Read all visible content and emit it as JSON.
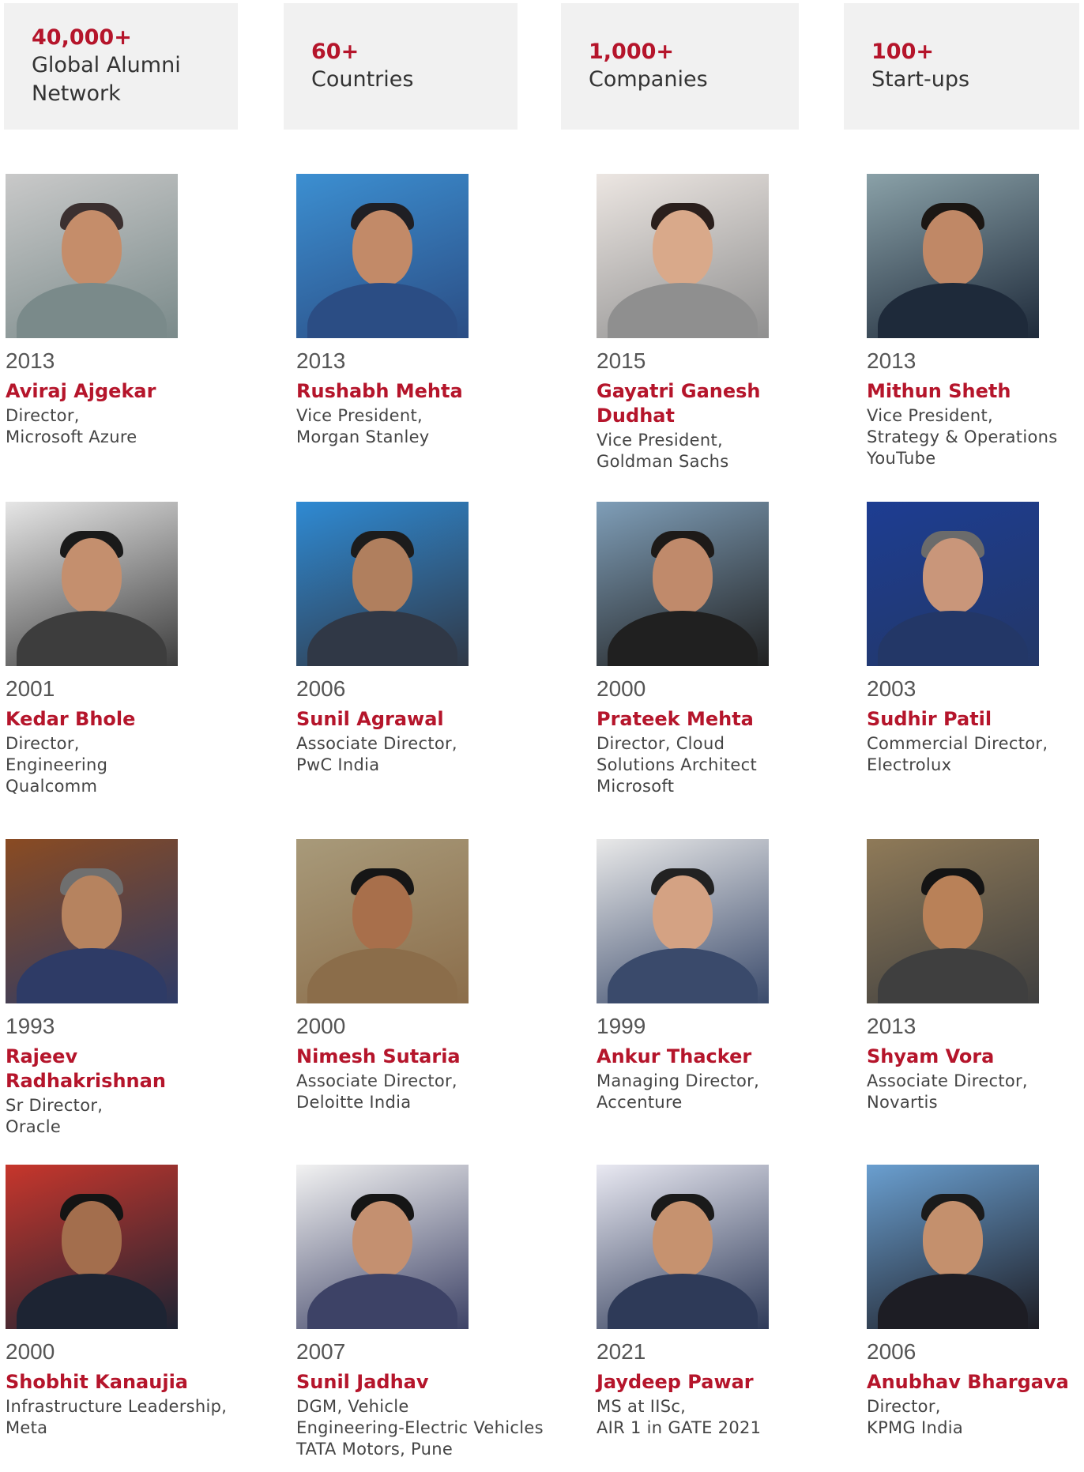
{
  "stats": [
    {
      "value": "40,000+",
      "label": "Global Alumni\nNetwork"
    },
    {
      "value": "60+",
      "label": "Countries"
    },
    {
      "value": "1,000+",
      "label": "Companies"
    },
    {
      "value": "100+",
      "label": "Start-ups"
    }
  ],
  "colors": {
    "accent": "#b5152b",
    "stat_bg": "#f1f1f1",
    "text": "#444444"
  },
  "alumni": [
    {
      "year": "2013",
      "name": "Aviraj Ajgekar",
      "role": [
        "Director,",
        "Microsoft Azure"
      ]
    },
    {
      "year": "2013",
      "name": "Rushabh Mehta",
      "role": [
        "Vice President,",
        "Morgan Stanley"
      ]
    },
    {
      "year": "2015",
      "name": "Gayatri Ganesh Dudhat",
      "role": [
        "Vice President,",
        "Goldman Sachs"
      ]
    },
    {
      "year": "2013",
      "name": "Mithun Sheth",
      "role": [
        "Vice President,",
        "Strategy & Operations",
        "YouTube"
      ]
    },
    {
      "year": "2001",
      "name": "Kedar Bhole",
      "role": [
        "Director,",
        "Engineering",
        "Qualcomm"
      ]
    },
    {
      "year": "2006",
      "name": "Sunil Agrawal",
      "role": [
        "Associate Director,",
        "PwC India"
      ]
    },
    {
      "year": "2000",
      "name": "Prateek Mehta",
      "role": [
        "Director, Cloud",
        "Solutions Architect",
        "Microsoft"
      ]
    },
    {
      "year": "2003",
      "name": "Sudhir Patil",
      "role": [
        "Commercial Director,",
        "Electrolux"
      ]
    },
    {
      "year": "1993",
      "name": "Rajeev Radhakrishnan",
      "role": [
        "Sr Director,",
        "Oracle"
      ]
    },
    {
      "year": "2000",
      "name": "Nimesh Sutaria",
      "role": [
        "Associate Director,",
        "Deloitte India"
      ]
    },
    {
      "year": "1999",
      "name": "Ankur Thacker",
      "role": [
        "Managing Director,",
        "Accenture"
      ]
    },
    {
      "year": "2013",
      "name": "Shyam Vora",
      "role": [
        "Associate Director,",
        "Novartis"
      ]
    },
    {
      "year": "2000",
      "name": "Shobhit Kanaujia",
      "role": [
        "Infrastructure Leadership,",
        "Meta"
      ]
    },
    {
      "year": "2007",
      "name": "Sunil Jadhav",
      "role": [
        "DGM, Vehicle",
        "Engineering-Electric Vehicles",
        "TATA Motors, Pune"
      ]
    },
    {
      "year": "2021",
      "name": "Jaydeep Pawar",
      "role": [
        "MS at IISc,",
        "AIR 1 in GATE 2021"
      ]
    },
    {
      "year": "2006",
      "name": "Anubhav Bhargava",
      "role": [
        "Director,",
        "KPMG India"
      ]
    }
  ]
}
